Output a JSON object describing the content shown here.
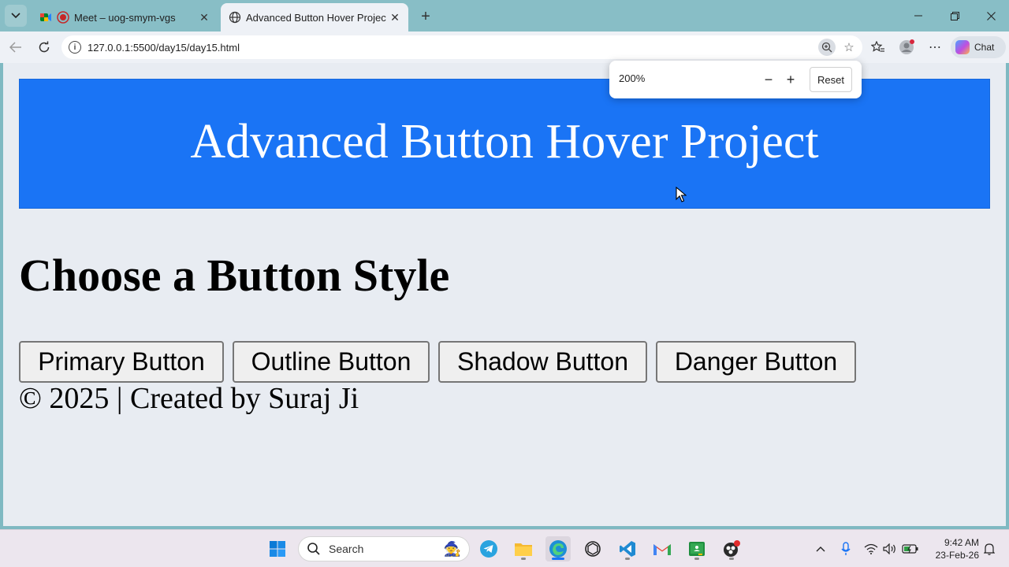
{
  "browser": {
    "tabs": [
      {
        "title": "Meet – uog-smym-vgs",
        "active": false
      },
      {
        "title": "Advanced Button Hover Project",
        "active": true
      }
    ],
    "url": "127.0.0.1:5500/day15/day15.html",
    "chat_label": "Chat"
  },
  "zoom_popup": {
    "level": "200%",
    "minus": "−",
    "plus": "+",
    "reset": "Reset"
  },
  "page": {
    "header_title": "Advanced Button Hover Project",
    "section_title": "Choose a Button Style",
    "buttons": [
      "Primary Button",
      "Outline Button",
      "Shadow Button",
      "Danger Button"
    ],
    "footer": "© 2025 | Created by Suraj Ji"
  },
  "taskbar": {
    "search_placeholder": "Search",
    "time": "9:42 AM",
    "date": "23-Feb-26"
  },
  "colors": {
    "header_bg": "#1a74f5",
    "page_bg": "#e8ecf2",
    "tabstrip_bg": "#88bec6"
  }
}
